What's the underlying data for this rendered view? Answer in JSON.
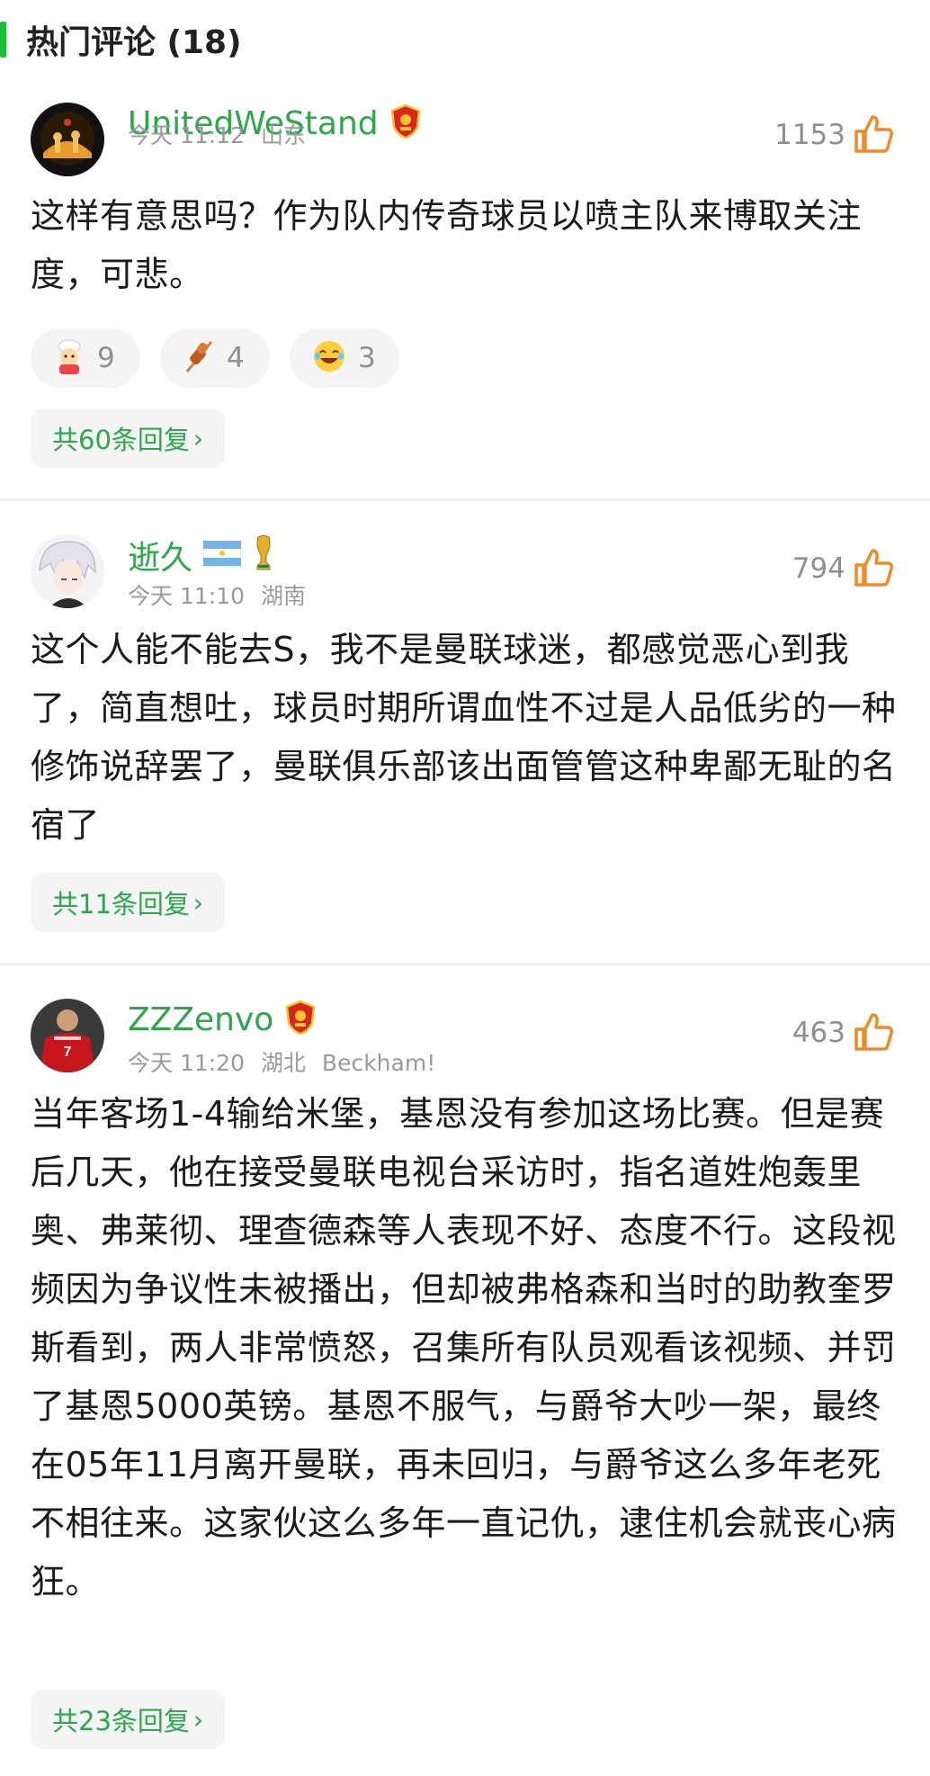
{
  "header": {
    "title": "热门评论 (18)"
  },
  "comments": [
    {
      "username": "UnitedWeStand",
      "time": "今天 11:12",
      "location": "山东",
      "extra": "",
      "likes": "1153",
      "content": "这样有意思吗？作为队内传奇球员以喷主队来博取关注度，可悲。",
      "reactions": [
        {
          "icon": "chef-emoji-icon",
          "count": "9"
        },
        {
          "icon": "skewer-emoji-icon",
          "count": "4"
        },
        {
          "icon": "laughing-emoji-icon",
          "count": "3"
        }
      ],
      "replies": "共60条回复"
    },
    {
      "username": "逝久",
      "time": "今天 11:10",
      "location": "湖南",
      "extra": "",
      "likes": "794",
      "content": "这个人能不能去S，我不是曼联球迷，都感觉恶心到我了，简直想吐，球员时期所谓血性不过是人品低劣的一种修饰说辞罢了，曼联俱乐部该出面管管这种卑鄙无耻的名宿了",
      "replies": "共11条回复"
    },
    {
      "username": "ZZZenvo",
      "time": "今天 11:20",
      "location": "湖北",
      "extra": "Beckham!",
      "likes": "463",
      "content": "当年客场1-4输给米堡，基恩没有参加这场比赛。但是赛后几天，他在接受曼联电视台采访时，指名道姓炮轰里奥、弗莱彻、理查德森等人表现不好、态度不行。这段视频因为争议性未被播出，但却被弗格森和当时的助教奎罗斯看到，两人非常愤怒，召集所有队员观看该视频、并罚了基恩5000英镑。基恩不服气，与爵爷大吵一架，最终在05年11月离开曼联，再未回归，与爵爷这么多年老死不相往来。这家伙这么多年一直记仇，逮住机会就丧心病狂。",
      "replies": "共23条回复"
    }
  ],
  "colors": {
    "accent": "#2aa84a",
    "bar": "#1dbf3a",
    "like_icon": "#f08a24"
  }
}
